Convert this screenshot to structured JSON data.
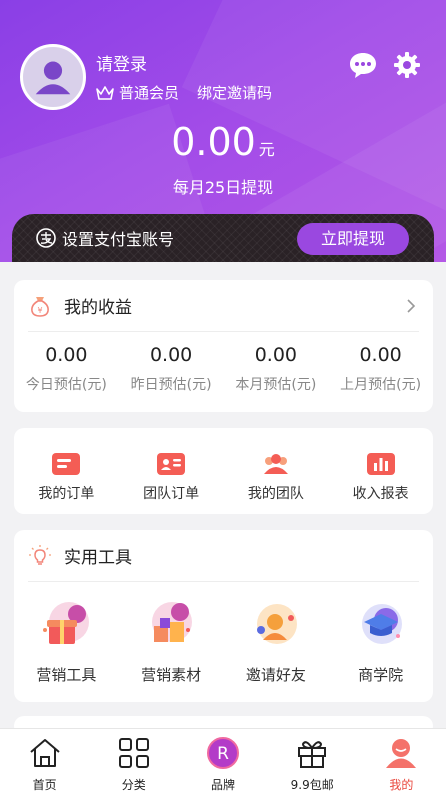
{
  "header": {
    "login_text": "请登录",
    "member_level": "普通会员",
    "bind_invite": "绑定邀请码",
    "balance": "0.00",
    "balance_unit": "元",
    "withdraw_note": "每月25日提现",
    "icons": [
      "chat-icon",
      "gear-icon"
    ]
  },
  "pay_bar": {
    "label": "设置支付宝账号",
    "button": "立即提现"
  },
  "earnings": {
    "title": "我的收益",
    "stats": [
      {
        "value": "0.00",
        "label": "今日预估(元)"
      },
      {
        "value": "0.00",
        "label": "昨日预估(元)"
      },
      {
        "value": "0.00",
        "label": "本月预估(元)"
      },
      {
        "value": "0.00",
        "label": "上月预估(元)"
      }
    ]
  },
  "orders": [
    {
      "label": "我的订单",
      "icon": "order-icon"
    },
    {
      "label": "团队订单",
      "icon": "team-order-icon"
    },
    {
      "label": "我的团队",
      "icon": "team-icon"
    },
    {
      "label": "收入报表",
      "icon": "report-icon"
    }
  ],
  "tools": {
    "title": "实用工具",
    "items": [
      {
        "label": "营销工具",
        "icon": "gift-icon"
      },
      {
        "label": "营销素材",
        "icon": "material-icon"
      },
      {
        "label": "邀请好友",
        "icon": "invite-icon"
      },
      {
        "label": "商学院",
        "icon": "school-icon"
      }
    ]
  },
  "tabbar": {
    "items": [
      {
        "label": "首页",
        "icon": "home-icon"
      },
      {
        "label": "分类",
        "icon": "category-icon"
      },
      {
        "label": "品牌",
        "icon": "brand-icon"
      },
      {
        "label": "9.9包邮",
        "icon": "gift-box-icon"
      },
      {
        "label": "我的",
        "icon": "profile-icon",
        "active": true
      }
    ]
  },
  "colors": {
    "primary_purple": "#9a48e0",
    "tab_active": "#e9483e",
    "card_bg": "#ffffff",
    "page_bg": "#f2f2f4"
  }
}
